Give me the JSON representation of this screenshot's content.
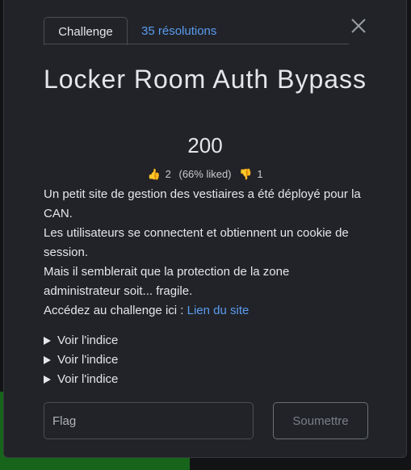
{
  "tabs": {
    "challenge": "Challenge",
    "solves": "35 résolutions"
  },
  "challenge": {
    "title": "Locker Room Auth Bypass",
    "value": "200",
    "likes": "2",
    "liked_pct": "(66% liked)",
    "dislikes": "1",
    "description": [
      "Un petit site de gestion des vestiaires a été déployé pour la CAN.",
      "Les utilisateurs se connectent et obtiennent un cookie de session.",
      "Mais il semblerait que la protection de la zone administrateur soit... fragile."
    ],
    "link_prefix": "Accédez au challenge ici : ",
    "link_text": "Lien du site"
  },
  "hints": [
    "Voir l'indice",
    "Voir l'indice",
    "Voir l'indice"
  ],
  "form": {
    "placeholder": "Flag",
    "submit": "Soumettre"
  }
}
